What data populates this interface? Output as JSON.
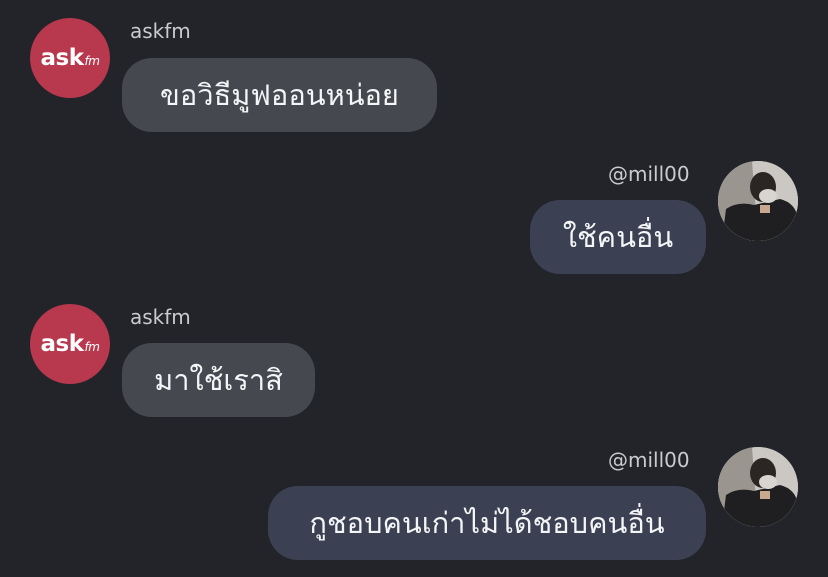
{
  "colors": {
    "background": "#232429",
    "incoming_bubble": "#46484f",
    "outgoing_bubble": "#3b4152",
    "askfm_brand": "#b8384d",
    "text": "#f4f5f7",
    "sender_text": "#c9cbd1"
  },
  "askfm_logo": {
    "ask": "ask",
    "fm": "fm"
  },
  "messages": [
    {
      "sender": "askfm",
      "text": "ขอวิธีมูฟออนหน่อย",
      "direction": "incoming"
    },
    {
      "sender": "@mill00",
      "text": "ใช้คนอื่น",
      "direction": "outgoing"
    },
    {
      "sender": "askfm",
      "text": "มาใช้เราสิ",
      "direction": "incoming"
    },
    {
      "sender": "@mill00",
      "text": "กูชอบคนเก่าไม่ได้ชอบคนอื่น",
      "direction": "outgoing"
    }
  ]
}
